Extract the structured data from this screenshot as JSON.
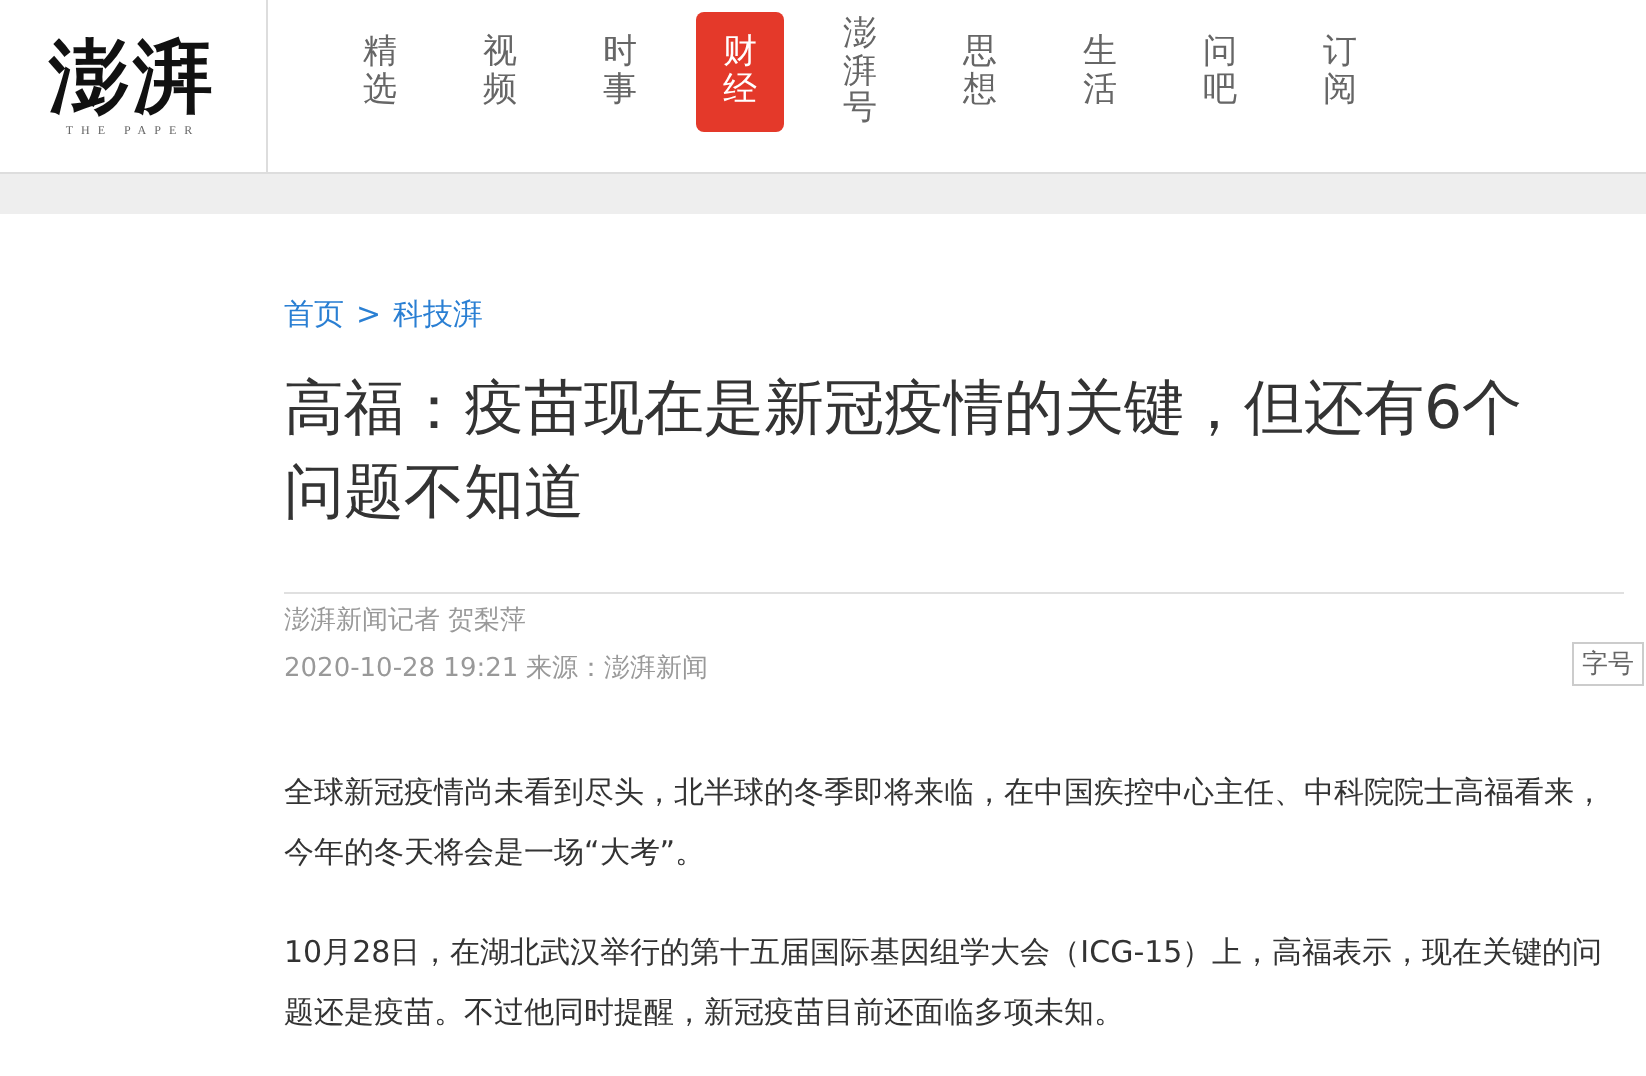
{
  "logo": {
    "text": "澎湃",
    "tagline": "THE PAPER"
  },
  "nav": [
    {
      "label": "精选",
      "selected": false
    },
    {
      "label": "视频",
      "selected": false
    },
    {
      "label": "时事",
      "selected": false
    },
    {
      "label": "财经",
      "selected": true
    },
    {
      "label": "澎湃号",
      "selected": false
    },
    {
      "label": "思想",
      "selected": false
    },
    {
      "label": "生活",
      "selected": false
    },
    {
      "label": "问吧",
      "selected": false
    },
    {
      "label": "订阅",
      "selected": false
    }
  ],
  "breadcrumb": [
    "首页",
    "科技湃"
  ],
  "breadcrumb_separator": ">",
  "article": {
    "title": "高福：疫苗现在是新冠疫情的关键，但还有6个问题不知道",
    "author": "澎湃新闻记者 贺梨萍",
    "date": "2020-10-28 19:21",
    "source": "来源：澎湃新闻",
    "font_size_button": "字号",
    "paragraphs": [
      "全球新冠疫情尚未看到尽头，北半球的冬季即将来临，在中国疾控中心主任、中科院院士高福看来，今年的冬天将会是一场“大考”。",
      "10月28日，在湖北武汉举行的第十五届国际基因组学大会（ICG-15）上，高福表示，现在关键的问题还是疫苗。不过他同时提醒，新冠疫苗目前还面临多项未知。"
    ]
  }
}
